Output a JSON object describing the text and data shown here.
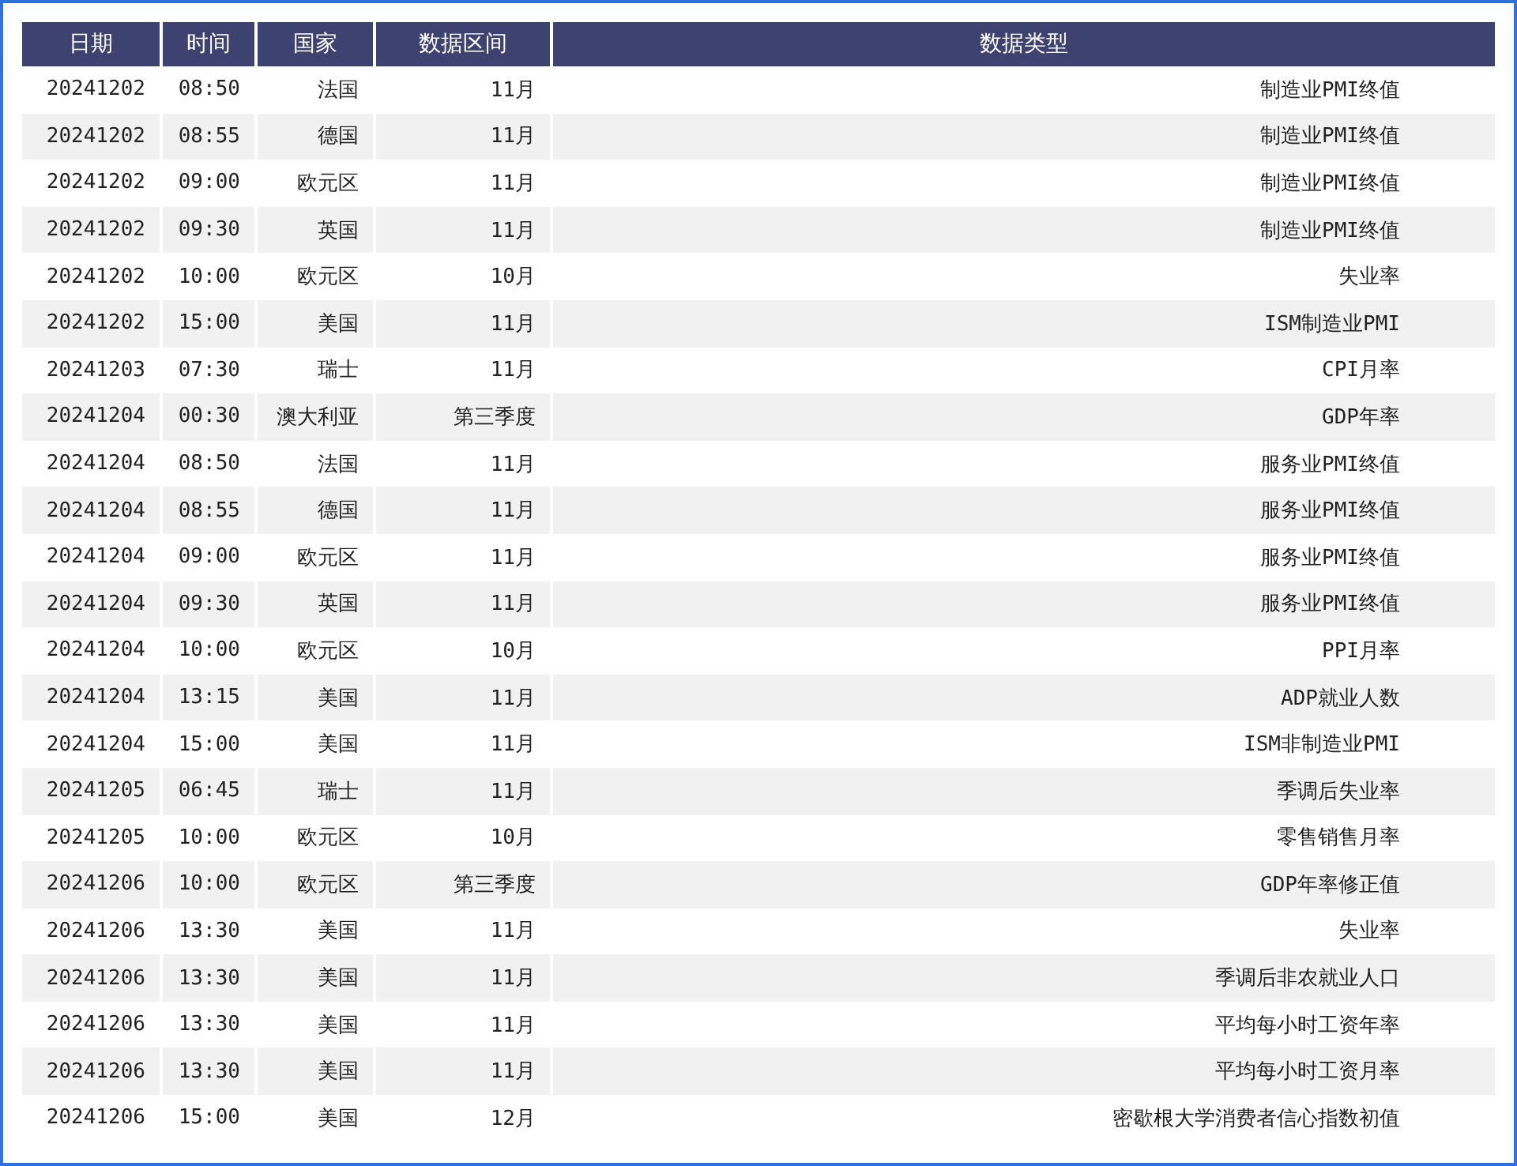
{
  "table": {
    "columns": [
      "日期",
      "时间",
      "国家",
      "数据区间",
      "数据类型"
    ],
    "rows": [
      [
        "20241202",
        "08:50",
        "法国",
        "11月",
        "制造业PMI终值"
      ],
      [
        "20241202",
        "08:55",
        "德国",
        "11月",
        "制造业PMI终值"
      ],
      [
        "20241202",
        "09:00",
        "欧元区",
        "11月",
        "制造业PMI终值"
      ],
      [
        "20241202",
        "09:30",
        "英国",
        "11月",
        "制造业PMI终值"
      ],
      [
        "20241202",
        "10:00",
        "欧元区",
        "10月",
        "失业率"
      ],
      [
        "20241202",
        "15:00",
        "美国",
        "11月",
        "ISM制造业PMI"
      ],
      [
        "20241203",
        "07:30",
        "瑞士",
        "11月",
        "CPI月率"
      ],
      [
        "20241204",
        "00:30",
        "澳大利亚",
        "第三季度",
        "GDP年率"
      ],
      [
        "20241204",
        "08:50",
        "法国",
        "11月",
        "服务业PMI终值"
      ],
      [
        "20241204",
        "08:55",
        "德国",
        "11月",
        "服务业PMI终值"
      ],
      [
        "20241204",
        "09:00",
        "欧元区",
        "11月",
        "服务业PMI终值"
      ],
      [
        "20241204",
        "09:30",
        "英国",
        "11月",
        "服务业PMI终值"
      ],
      [
        "20241204",
        "10:00",
        "欧元区",
        "10月",
        "PPI月率"
      ],
      [
        "20241204",
        "13:15",
        "美国",
        "11月",
        "ADP就业人数"
      ],
      [
        "20241204",
        "15:00",
        "美国",
        "11月",
        "ISM非制造业PMI"
      ],
      [
        "20241205",
        "06:45",
        "瑞士",
        "11月",
        "季调后失业率"
      ],
      [
        "20241205",
        "10:00",
        "欧元区",
        "10月",
        "零售销售月率"
      ],
      [
        "20241206",
        "10:00",
        "欧元区",
        "第三季度",
        "GDP年率修正值"
      ],
      [
        "20241206",
        "13:30",
        "美国",
        "11月",
        "失业率"
      ],
      [
        "20241206",
        "13:30",
        "美国",
        "11月",
        "季调后非农就业人口"
      ],
      [
        "20241206",
        "13:30",
        "美国",
        "11月",
        "平均每小时工资年率"
      ],
      [
        "20241206",
        "13:30",
        "美国",
        "11月",
        "平均每小时工资月率"
      ],
      [
        "20241206",
        "15:00",
        "美国",
        "12月",
        "密歇根大学消费者信心指数初值"
      ]
    ]
  }
}
